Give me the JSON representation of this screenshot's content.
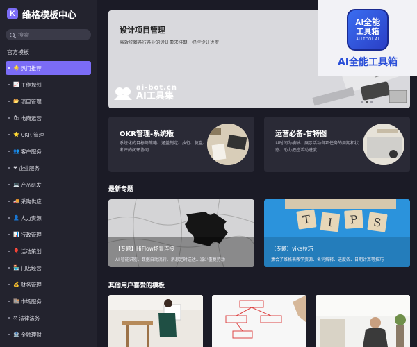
{
  "brand": {
    "logo_letter": "K",
    "name": "维格模板中心"
  },
  "search": {
    "placeholder": "搜索"
  },
  "sidebar": {
    "section_label": "官方模板",
    "items": [
      {
        "emoji": "🌟",
        "label": "热门推荐",
        "active": true
      },
      {
        "emoji": "📈",
        "label": "工作规划"
      },
      {
        "emoji": "📂",
        "label": "项目管理"
      },
      {
        "emoji": "🛍",
        "label": "电商运营"
      },
      {
        "emoji": "⭐",
        "label": "OKR 管理"
      },
      {
        "emoji": "👥",
        "label": "客户服务"
      },
      {
        "emoji": "❤",
        "label": "企业服务"
      },
      {
        "emoji": "💻",
        "label": "产品研发"
      },
      {
        "emoji": "🚚",
        "label": "采购供应"
      },
      {
        "emoji": "👤",
        "label": "人力资源"
      },
      {
        "emoji": "📊",
        "label": "行政管理"
      },
      {
        "emoji": "🎈",
        "label": "活动策划"
      },
      {
        "emoji": "🏪",
        "label": "门店经营"
      },
      {
        "emoji": "💰",
        "label": "财务管理"
      },
      {
        "emoji": "🏬",
        "label": "市场服务"
      },
      {
        "emoji": "⚖",
        "label": "法律法务"
      },
      {
        "emoji": "🏦",
        "label": "金融理财"
      }
    ]
  },
  "banner": {
    "title": "设计项目管理",
    "subtitle": "高效统筹各行各业的设计需求排期、把控设计进度",
    "watermark_top": "ai-bot.cn",
    "watermark_bottom": "AI工具集"
  },
  "cards": [
    {
      "title": "OKR管理-系统版",
      "desc": "系统化的目标与策略、涵盖制定、执行、复盘、考评的闭环协同"
    },
    {
      "title": "运营必备-甘特图",
      "desc": "以时间为横轴、展示活动各项任务的周期和状态、助力把控活动进度"
    }
  ],
  "sections": {
    "latest": "最新专题",
    "favorites": "其他用户喜爱的模板"
  },
  "topics": [
    {
      "title": "【专题】HiFlow场景连接",
      "sub": "AI 智能识别、数据自动流转、消息定时送达…减少重复劳动"
    },
    {
      "title": "【专题】vika技巧",
      "sub": "集合了维格表教学资源、名词解释、进度条、日期计算等技巧",
      "tiles": [
        "T",
        "I",
        "P",
        "S"
      ]
    }
  ],
  "overlay": {
    "l1": "AI全能",
    "l2": "工具箱",
    "l3": "ALLTOOL.AI",
    "caption": "AI全能工具箱"
  },
  "colors": {
    "accent": "#7b6cf6",
    "bg": "#1b1b26",
    "sidebar": "#23232e",
    "card": "#2a2a36"
  }
}
